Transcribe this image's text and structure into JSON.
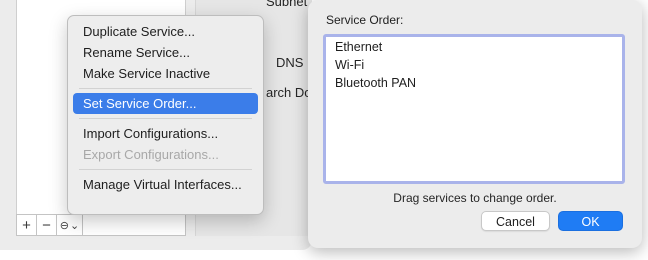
{
  "background": {
    "labels": {
      "subnet": "Subnet",
      "dns": "DNS",
      "search": "arch Do"
    },
    "bottom_bar": {
      "add": "+",
      "remove": "−",
      "action_icon": "⊖",
      "action_chevron": "⌄"
    }
  },
  "context_menu": {
    "items": [
      {
        "label": "Duplicate Service..."
      },
      {
        "label": "Rename Service..."
      },
      {
        "label": "Make Service Inactive"
      },
      {
        "label": "Set Service Order..."
      },
      {
        "label": "Import Configurations..."
      },
      {
        "label": "Export Configurations..."
      },
      {
        "label": "Manage Virtual Interfaces..."
      }
    ],
    "selected": "Set Service Order...",
    "disabled": [
      "Export Configurations..."
    ]
  },
  "dialog": {
    "title": "Service Order:",
    "services": [
      "Ethernet",
      "Wi-Fi",
      "Bluetooth PAN"
    ],
    "hint": "Drag services to change order.",
    "cancel_label": "Cancel",
    "ok_label": "OK"
  },
  "colors": {
    "accent": "#3b7de9",
    "ok_button": "#1f7cf4",
    "list_focus_ring": "#a9b3ea"
  }
}
